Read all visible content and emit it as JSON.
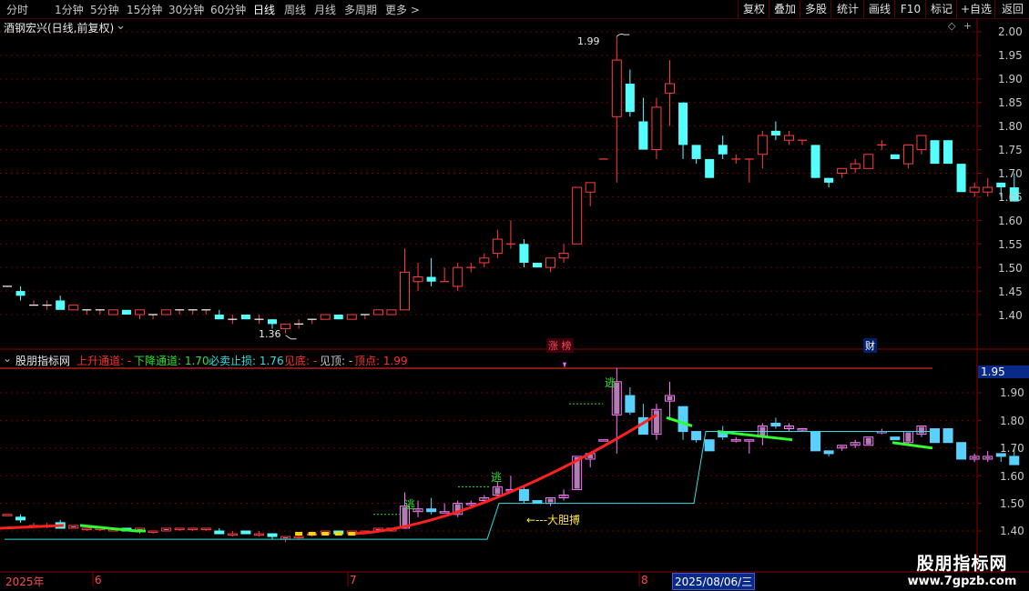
{
  "toolbar": {
    "periods": [
      "分时",
      "1分钟",
      "5分钟",
      "15分钟",
      "30分钟",
      "60分钟",
      "日线",
      "周线",
      "月线",
      "多周期",
      "更多 >"
    ],
    "active_period": "日线",
    "right_buttons": [
      "复权",
      "叠加",
      "多股",
      "统计",
      "画线",
      "F10",
      "标记",
      "+自选",
      "返回"
    ]
  },
  "main_chart": {
    "title": "酒钢宏兴(日线,前复权)",
    "y_ticks": [
      "2.00",
      "1.95",
      "1.90",
      "1.85",
      "1.80",
      "1.75",
      "1.70",
      "1.65",
      "1.60",
      "1.55",
      "1.50",
      "1.45",
      "1.40"
    ],
    "high_label": "1.99",
    "low_label": "1.36",
    "badge_limit_up": "涨 榜",
    "badge_finance": "财"
  },
  "indicator": {
    "name": "股朋指标网",
    "items": [
      {
        "label": "上升通道: -",
        "color": "#ff3030"
      },
      {
        "label": "下降通道: 1.70",
        "color": "#30e030"
      },
      {
        "label": "必卖止损: 1.76",
        "color": "#30e0e0"
      },
      {
        "label": "见底: -",
        "color": "#ff3030"
      },
      {
        "label": "见顶: -",
        "color": "#c8c8c8"
      },
      {
        "label": "顶点: 1.99",
        "color": "#ff3030"
      }
    ],
    "y_ticks": [
      "1.90",
      "1.80",
      "1.70",
      "1.60",
      "1.50",
      "1.40"
    ],
    "current_value": "1.95",
    "escape_label": "逃",
    "bold_label": "←---大胆搏",
    "signal_top": "1.99"
  },
  "date_axis": {
    "labels": [
      "2025年",
      "6",
      "7",
      "8"
    ],
    "cursor_date": "2025/08/06/三"
  },
  "watermark": {
    "name": "股朋指标网",
    "url": "www.7gpzb.com"
  },
  "colors": {
    "up": "#ff3c3c",
    "down": "#54ffff",
    "grid": "#6e0000",
    "escape": "#30e030",
    "pink": "#ff64ff",
    "cyan": "#30e0e0"
  },
  "chart_data": {
    "type": "candlestick",
    "title": "酒钢宏兴(日线,前复权)",
    "ylim": [
      1.36,
      2.02
    ],
    "candles": [
      [
        1.46,
        1.46,
        1.46,
        1.46
      ],
      [
        1.45,
        1.46,
        1.43,
        1.44
      ],
      [
        1.42,
        1.43,
        1.42,
        1.42
      ],
      [
        1.42,
        1.43,
        1.41,
        1.42
      ],
      [
        1.43,
        1.44,
        1.42,
        1.41
      ],
      [
        1.41,
        1.42,
        1.41,
        1.42
      ],
      [
        1.41,
        1.41,
        1.4,
        1.41
      ],
      [
        1.41,
        1.41,
        1.4,
        1.41
      ],
      [
        1.4,
        1.41,
        1.4,
        1.41
      ],
      [
        1.41,
        1.41,
        1.4,
        1.4
      ],
      [
        1.4,
        1.41,
        1.39,
        1.41
      ],
      [
        1.4,
        1.4,
        1.39,
        1.4
      ],
      [
        1.4,
        1.41,
        1.4,
        1.41
      ],
      [
        1.41,
        1.41,
        1.4,
        1.41
      ],
      [
        1.41,
        1.41,
        1.4,
        1.41
      ],
      [
        1.41,
        1.41,
        1.4,
        1.41
      ],
      [
        1.4,
        1.41,
        1.39,
        1.39
      ],
      [
        1.39,
        1.4,
        1.38,
        1.39
      ],
      [
        1.4,
        1.4,
        1.39,
        1.39
      ],
      [
        1.39,
        1.4,
        1.38,
        1.39
      ],
      [
        1.39,
        1.39,
        1.37,
        1.38
      ],
      [
        1.37,
        1.38,
        1.36,
        1.38
      ],
      [
        1.38,
        1.39,
        1.37,
        1.38
      ],
      [
        1.39,
        1.39,
        1.38,
        1.39
      ],
      [
        1.39,
        1.4,
        1.39,
        1.4
      ],
      [
        1.4,
        1.4,
        1.39,
        1.39
      ],
      [
        1.39,
        1.4,
        1.39,
        1.4
      ],
      [
        1.4,
        1.4,
        1.39,
        1.4
      ],
      [
        1.4,
        1.41,
        1.4,
        1.41
      ],
      [
        1.4,
        1.41,
        1.4,
        1.41
      ],
      [
        1.41,
        1.54,
        1.41,
        1.49
      ],
      [
        1.47,
        1.51,
        1.45,
        1.48
      ],
      [
        1.48,
        1.52,
        1.46,
        1.47
      ],
      [
        1.47,
        1.5,
        1.47,
        1.47
      ],
      [
        1.46,
        1.51,
        1.45,
        1.5
      ],
      [
        1.5,
        1.51,
        1.49,
        1.5
      ],
      [
        1.51,
        1.53,
        1.5,
        1.52
      ],
      [
        1.53,
        1.58,
        1.52,
        1.56
      ],
      [
        1.55,
        1.6,
        1.54,
        1.55
      ],
      [
        1.55,
        1.56,
        1.5,
        1.51
      ],
      [
        1.51,
        1.51,
        1.5,
        1.5
      ],
      [
        1.5,
        1.52,
        1.49,
        1.52
      ],
      [
        1.52,
        1.55,
        1.51,
        1.53
      ],
      [
        1.55,
        1.67,
        1.55,
        1.67
      ],
      [
        1.66,
        1.68,
        1.63,
        1.68
      ],
      [
        1.73,
        1.73,
        1.73,
        1.73
      ],
      [
        1.82,
        1.99,
        1.68,
        1.94
      ],
      [
        1.89,
        1.92,
        1.82,
        1.83
      ],
      [
        1.81,
        1.86,
        1.75,
        1.75
      ],
      [
        1.75,
        1.86,
        1.73,
        1.84
      ],
      [
        1.87,
        1.94,
        1.8,
        1.89
      ],
      [
        1.85,
        1.85,
        1.73,
        1.76
      ],
      [
        1.76,
        1.76,
        1.72,
        1.73
      ],
      [
        1.73,
        1.73,
        1.69,
        1.69
      ],
      [
        1.76,
        1.78,
        1.73,
        1.74
      ],
      [
        1.73,
        1.74,
        1.72,
        1.73
      ],
      [
        1.73,
        1.73,
        1.68,
        1.73
      ],
      [
        1.74,
        1.79,
        1.71,
        1.78
      ],
      [
        1.79,
        1.81,
        1.77,
        1.78
      ],
      [
        1.77,
        1.79,
        1.76,
        1.78
      ],
      [
        1.77,
        1.77,
        1.76,
        1.77
      ],
      [
        1.76,
        1.76,
        1.69,
        1.69
      ],
      [
        1.69,
        1.69,
        1.67,
        1.68
      ],
      [
        1.7,
        1.7,
        1.69,
        1.71
      ],
      [
        1.71,
        1.73,
        1.7,
        1.72
      ],
      [
        1.71,
        1.74,
        1.71,
        1.74
      ],
      [
        1.76,
        1.77,
        1.75,
        1.76
      ],
      [
        1.74,
        1.74,
        1.73,
        1.73
      ],
      [
        1.72,
        1.75,
        1.71,
        1.76
      ],
      [
        1.75,
        1.78,
        1.74,
        1.78
      ],
      [
        1.77,
        1.77,
        1.75,
        1.72
      ],
      [
        1.77,
        1.77,
        1.72,
        1.72
      ],
      [
        1.72,
        1.72,
        1.68,
        1.66
      ],
      [
        1.66,
        1.68,
        1.65,
        1.67
      ],
      [
        1.66,
        1.69,
        1.65,
        1.67
      ],
      [
        1.68,
        1.68,
        1.65,
        1.67
      ],
      [
        1.67,
        1.7,
        1.64,
        1.64
      ]
    ]
  }
}
